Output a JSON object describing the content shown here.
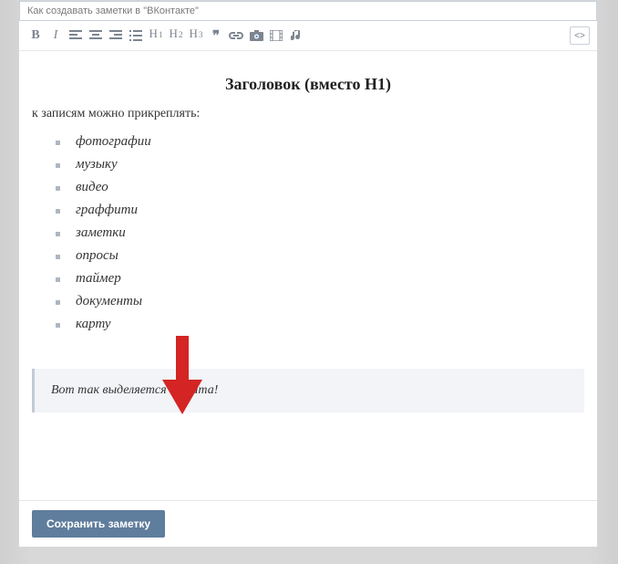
{
  "title_input": {
    "value": "Как создавать заметки в \"ВКонтакте\""
  },
  "toolbar": {
    "bold": "B",
    "italic": "I",
    "h1": "H",
    "h1_sub": "1",
    "h2": "H",
    "h2_sub": "2",
    "h3": "H",
    "h3_sub": "3",
    "quote": "❞",
    "code": "<>"
  },
  "content": {
    "heading": "Заголовок (вместо H1)",
    "intro": "к записям можно прикреплять:",
    "items": [
      "фотографии",
      "музыку",
      "видео",
      "граффити",
      "заметки",
      "опросы",
      "таймер",
      "документы",
      "карту"
    ],
    "quote": "Вот так выделяется цитата!"
  },
  "footer": {
    "save_label": "Сохранить заметку"
  },
  "colors": {
    "accent": "#5f7d9d",
    "arrow": "#d42424"
  }
}
